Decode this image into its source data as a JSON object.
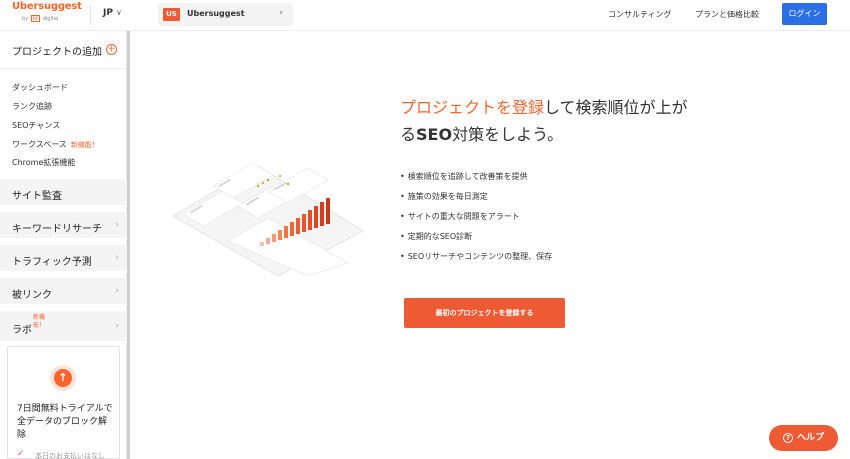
{
  "header": {
    "brand": "Ubersuggest",
    "brand_by": "by",
    "brand_np": "NP",
    "brand_sub": "digital",
    "language": "JP",
    "language_chevron": "∨",
    "project_badge": "US",
    "project_name": "Ubersuggest",
    "project_chevron": "›",
    "nav_consulting": "コンサルティング",
    "nav_plans": "プランと価格比較",
    "login": "ログイン"
  },
  "sidebar": {
    "add_project": "プロジェクトの追加",
    "add_icon": "⊕",
    "sub_items": [
      {
        "label": "ダッシュボード"
      },
      {
        "label": "ランク追跡"
      },
      {
        "label": "SEOチャンス"
      },
      {
        "label": "ワークスペース",
        "badge": "新機能！"
      },
      {
        "label": "Chrome拡張機能"
      }
    ],
    "sections": [
      {
        "label": "サイト監査",
        "chevron": ""
      },
      {
        "label": "キーワードリサーチ",
        "chevron": "›"
      },
      {
        "label": "トラフィック予測",
        "chevron": "›"
      },
      {
        "label": "被リンク",
        "chevron": "›"
      },
      {
        "label": "ラボ",
        "badge": "新機能！",
        "chevron": "›"
      }
    ],
    "trial": {
      "icon": "↑",
      "text": "7日間無料トライアルで全データのブロック解除",
      "check": "✓",
      "faded": "本日のお支払いはなし"
    }
  },
  "main": {
    "headline_hl": "プロジェクトを登録",
    "headline_rest1": "して検索順位が上がる",
    "headline_seo": "SEO",
    "headline_rest2": "対策をしよう。",
    "bullets": [
      "検索順位を追跡して改善策を提供",
      "施策の効果を毎日測定",
      "サイトの重大な問題をアラート",
      "定期的なSEO診断",
      "SEOリサーチやコンテンツの整理、保存"
    ],
    "cta": "最初のプロジェクトを登録する"
  },
  "help": {
    "label": "ヘルプ",
    "icon": "?"
  },
  "colors": {
    "accent": "#ee5a34",
    "brand": "#ff642d",
    "login": "#2b6fe6"
  }
}
